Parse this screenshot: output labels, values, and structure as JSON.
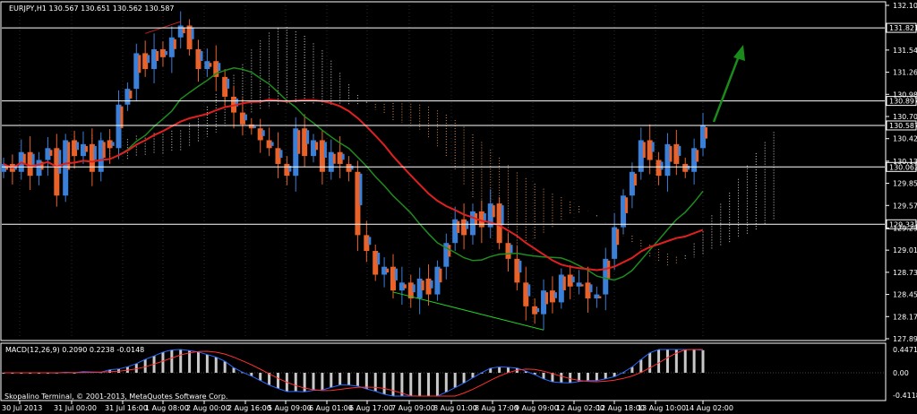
{
  "window": {
    "symbol_header": "EURJPY,H1  130.567 130.651 130.562 130.587",
    "copyright": "Skopalino Terminal, © 2001-2013, MetaQuotes Software Corp.",
    "macd_header": "MACD(12,26,9) 0.2090 0.2238 -0.0148"
  },
  "colors": {
    "background": "#000000",
    "bull_candle": "#3a7fd8",
    "bear_candle": "#e8622a",
    "ma_red": "#e02020",
    "ma_green": "#1e8c1e",
    "trend_green": "#22cc22",
    "cloud_white": "#cfcfcf",
    "cloud_orange": "#d98b4a",
    "macd_blue": "#2a6bff",
    "macd_red": "#ff3030",
    "macd_hist": "#c8c8c8",
    "arrow_green": "#1a8a1a"
  },
  "chart_data": {
    "type": "candlestick",
    "symbol": "EURJPY",
    "timeframe": "H1",
    "last_quote": {
      "open": 130.567,
      "high": 130.651,
      "low": 130.562,
      "close": 130.587
    },
    "y_ticks": [
      "132.105",
      "131.540",
      "131.260",
      "130.980",
      "130.700",
      "130.420",
      "130.135",
      "129.855",
      "129.575",
      "129.290",
      "129.010",
      "128.730",
      "128.450",
      "128.170",
      "127.890"
    ],
    "marked_levels": [
      "131.821",
      "130.897",
      "130.587",
      "130.062",
      "129.337"
    ],
    "ylim": [
      127.89,
      132.105
    ],
    "x_ticks": [
      "30 Jul 2013",
      "31 Jul 00:00",
      "31 Jul 16:00",
      "1 Aug 08:00",
      "2 Aug 00:00",
      "2 Aug 16:00",
      "5 Aug 09:00",
      "6 Aug 01:00",
      "6 Aug 17:00",
      "7 Aug 09:00",
      "8 Aug 01:00",
      "8 Aug 17:00",
      "9 Aug 09:00",
      "12 Aug 02:00",
      "12 Aug 18:00",
      "13 Aug 10:00",
      "14 Aug 02:00"
    ],
    "close_path": [
      130.1,
      130.0,
      130.25,
      129.95,
      130.15,
      130.3,
      129.7,
      130.4,
      130.2,
      130.35,
      130.0,
      130.4,
      130.3,
      130.85,
      131.05,
      131.5,
      131.3,
      131.55,
      131.45,
      131.7,
      131.85,
      131.55,
      131.3,
      131.4,
      131.2,
      130.95,
      130.75,
      130.6,
      130.55,
      130.4,
      130.3,
      130.1,
      129.95,
      130.55,
      130.2,
      130.4,
      130.0,
      130.25,
      130.1,
      130.0,
      129.2,
      129.0,
      128.7,
      128.8,
      128.5,
      128.6,
      128.4,
      128.65,
      128.45,
      128.8,
      129.1,
      129.4,
      129.2,
      129.5,
      129.3,
      129.6,
      129.1,
      128.9,
      128.6,
      128.3,
      128.2,
      128.5,
      128.35,
      128.7,
      128.55,
      128.6,
      128.4,
      128.45,
      128.9,
      129.3,
      129.7,
      130.0,
      130.4,
      130.15,
      129.95,
      130.35,
      130.1,
      130.0,
      130.3,
      130.587
    ],
    "macd": {
      "name": "MACD(12,26,9)",
      "values": {
        "main": 0.209,
        "signal": 0.2238,
        "histogram": -0.0148
      },
      "y_ticks": [
        "0.4471",
        "0.00",
        "-0.4118"
      ]
    }
  }
}
